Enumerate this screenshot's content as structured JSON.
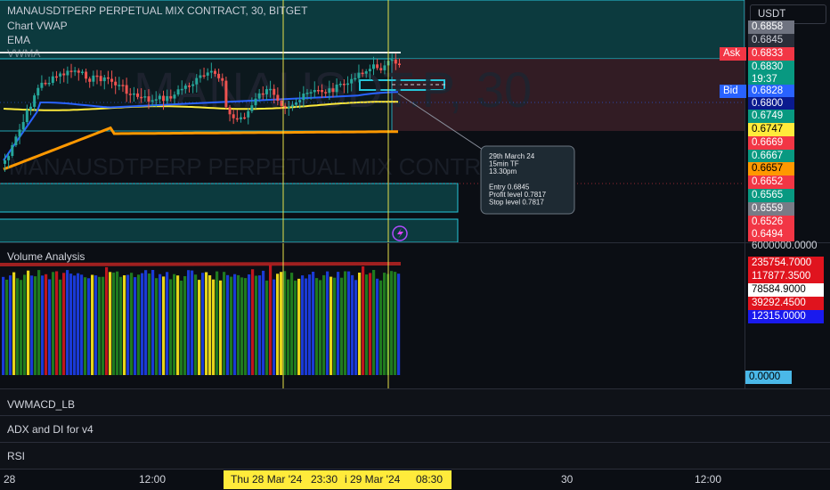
{
  "header": {
    "symbol_title": "MANAUSDTPERP PERPETUAL MIX CONTRACT, 30, BITGET",
    "indicators": [
      "Chart VWAP",
      "EMA",
      "VWMA"
    ]
  },
  "currency_selector": "USDT",
  "watermark": {
    "top": "MANAUSDT.P, 30",
    "bottom": "MANAUSDTPERP PERPETUAL MIX CONTRACT"
  },
  "price_axis": {
    "labels": [
      {
        "text": "0.6858",
        "bg": "#6f7380",
        "fg": "#ffffff"
      },
      {
        "text": "0.6845",
        "bg": "#2a2e39",
        "fg": "#d1d4dc"
      },
      {
        "text": "0.6833",
        "bg": "#f23645",
        "fg": "#ffffff",
        "tag": "Ask",
        "tag_bg": "#f23645"
      },
      {
        "text": "0.6830",
        "bg": "#089981",
        "fg": "#ffffff"
      },
      {
        "text": "19:37",
        "bg": "#089981",
        "fg": "#ffffff"
      },
      {
        "text": "0.6828",
        "bg": "#2962ff",
        "fg": "#ffffff",
        "tag": "Bid",
        "tag_bg": "#2962ff"
      },
      {
        "text": "0.6800",
        "bg": "#0a1a8f",
        "fg": "#ffffff"
      },
      {
        "text": "0.6749",
        "bg": "#089981",
        "fg": "#ffffff"
      },
      {
        "text": "0.6747",
        "bg": "#ffeb3b",
        "fg": "#000000"
      },
      {
        "text": "0.6669",
        "bg": "#f23645",
        "fg": "#ffffff"
      },
      {
        "text": "0.6667",
        "bg": "#089981",
        "fg": "#ffffff"
      },
      {
        "text": "0.6657",
        "bg": "#ff9800",
        "fg": "#000000"
      },
      {
        "text": "0.6652",
        "bg": "#f23645",
        "fg": "#ffffff"
      },
      {
        "text": "0.6565",
        "bg": "#089981",
        "fg": "#ffffff"
      },
      {
        "text": "0.6559",
        "bg": "#787b86",
        "fg": "#ffffff"
      },
      {
        "text": "0.6526",
        "bg": "#f23645",
        "fg": "#ffffff"
      },
      {
        "text": "0.6494",
        "bg": "#f23645",
        "fg": "#ffffff"
      }
    ],
    "volume_scale_top": "6000000.0000"
  },
  "annotation": {
    "lines": [
      "29th March 24",
      "15min TF",
      "13.30pm",
      "",
      "Entry 0.6845",
      "Profit level 0.7817",
      "Stop level 0.7817"
    ]
  },
  "volume_pane": {
    "title": "Volume Analysis",
    "labels": [
      {
        "text": "235754.7000",
        "bg": "#e0141e",
        "fg": "#ffffff"
      },
      {
        "text": "117877.3500",
        "bg": "#e0141e",
        "fg": "#ffffff"
      },
      {
        "text": "78584.9000",
        "bg": "#ffffff",
        "fg": "#000000"
      },
      {
        "text": "39292.4500",
        "bg": "#e0141e",
        "fg": "#ffffff"
      },
      {
        "text": "12315.0000",
        "bg": "#1a1aee",
        "fg": "#ffffff"
      }
    ],
    "zero_label": "0.0000"
  },
  "collapsed_panes": [
    "VWMACD_LB",
    "ADX and DI for v4",
    "RSI"
  ],
  "time_axis": {
    "ticks": [
      "28",
      "12:00",
      "30",
      "12:00"
    ],
    "crosshair_labels": [
      "Thu 28 Mar '24",
      "23:30",
      "i 29 Mar '24",
      "08:30"
    ]
  },
  "colors": {
    "up": "#26a69a",
    "down": "#ef5350",
    "zone_border": "#26c6da",
    "vwap": "#ffeb3b",
    "ema": "#2962ff",
    "vwma": "#ff9800"
  }
}
